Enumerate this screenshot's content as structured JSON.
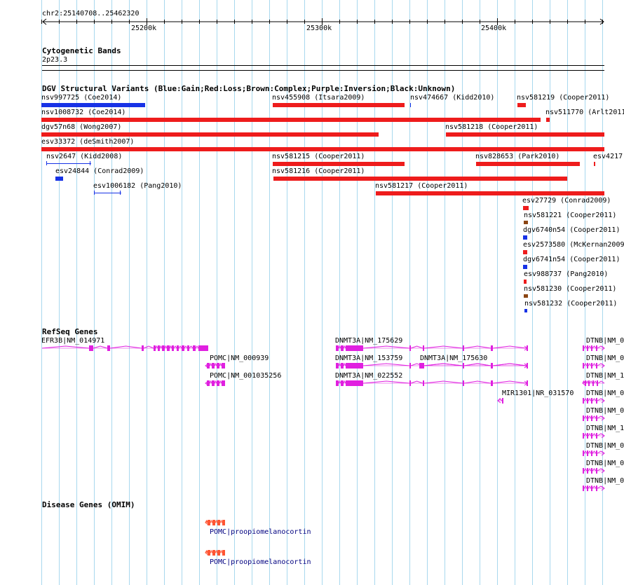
{
  "colors": {
    "loss": "#ee1c1c",
    "gain": "#1732e6",
    "complex": "#8b4513",
    "gene": "#e020e0",
    "disease": "#ff5533",
    "disease_text": "#000080",
    "grid": "#a8d8ee"
  },
  "ruler": {
    "location": "chr2:25140708..25462320",
    "ticks": [
      "25200k",
      "25300k",
      "25400k"
    ]
  },
  "tracks": {
    "cyto": {
      "title": "Cytogenetic Bands",
      "band": "2p23.3"
    },
    "dgv": {
      "title": "DGV Structural Variants (Blue:Gain;Red:Loss;Brown:Complex;Purple:Inversion;Black:Unknown)"
    },
    "refseq": {
      "title": "RefSeq Genes"
    },
    "omim": {
      "title": "Disease Genes (OMIM)"
    }
  },
  "variants": [
    {
      "label": "nsv997725 (Coe2014)",
      "type": "gain"
    },
    {
      "label": "nsv455908 (Itsara2009)",
      "type": "loss"
    },
    {
      "label": "nsv474667 (Kidd2010)",
      "type": "gain"
    },
    {
      "label": "nsv581219 (Cooper2011)",
      "type": "loss"
    },
    {
      "label": "nsv1008732 (Coe2014)",
      "type": "loss"
    },
    {
      "label": "nsv511770 (Arlt2011)",
      "type": "loss"
    },
    {
      "label": "dgv57n68 (Wong2007)",
      "type": "loss"
    },
    {
      "label": "nsv581218 (Cooper2011)",
      "type": "loss"
    },
    {
      "label": "esv33372 (deSmith2007)",
      "type": "loss"
    },
    {
      "label": "nsv2647 (Kidd2008)",
      "type": "gain"
    },
    {
      "label": "nsv581215 (Cooper2011)",
      "type": "loss"
    },
    {
      "label": "nsv828653 (Park2010)",
      "type": "loss"
    },
    {
      "label": "esv4217",
      "type": "loss"
    },
    {
      "label": "esv24844 (Conrad2009)",
      "type": "gain"
    },
    {
      "label": "nsv581216 (Cooper2011)",
      "type": "loss"
    },
    {
      "label": "esv1006182 (Pang2010)",
      "type": "gain"
    },
    {
      "label": "nsv581217 (Cooper2011)",
      "type": "loss"
    },
    {
      "label": "esv27729 (Conrad2009)",
      "type": "loss"
    },
    {
      "label": "nsv581221 (Cooper2011)",
      "type": "complex"
    },
    {
      "label": "dgv6740n54 (Cooper2011)",
      "type": "gain"
    },
    {
      "label": "esv2573580 (McKernan2009",
      "type": "loss"
    },
    {
      "label": "dgv6741n54 (Cooper2011)",
      "type": "gain"
    },
    {
      "label": "esv988737 (Pang2010)",
      "type": "loss"
    },
    {
      "label": "nsv581230 (Cooper2011)",
      "type": "complex"
    },
    {
      "label": "nsv581232 (Cooper2011)",
      "type": "gain"
    }
  ],
  "genes": [
    {
      "label": "EFR3B|NM_014971"
    },
    {
      "label": "DNMT3A|NM_175629"
    },
    {
      "label": "DTNB|NM_0"
    },
    {
      "label": "POMC|NM_000939"
    },
    {
      "label": "DNMT3A|NM_153759"
    },
    {
      "label": "DNMT3A|NM_175630"
    },
    {
      "label": "DTNB|NM_0"
    },
    {
      "label": "POMC|NM_001035256"
    },
    {
      "label": "DNMT3A|NM_022552"
    },
    {
      "label": "DTNB|NM_1"
    },
    {
      "label": "DTNB|NM_0"
    },
    {
      "label": "MIR1301|NR_031570"
    },
    {
      "label": "DTNB|NM_0"
    },
    {
      "label": "DTNB|NM_1"
    },
    {
      "label": "DTNB|NM_0"
    },
    {
      "label": "DTNB|NM_0"
    },
    {
      "label": "DTNB|NM_0"
    }
  ],
  "omim": [
    {
      "label": "POMC|proopiomelanocortin"
    },
    {
      "label": "POMC|proopiomelanocortin"
    }
  ]
}
